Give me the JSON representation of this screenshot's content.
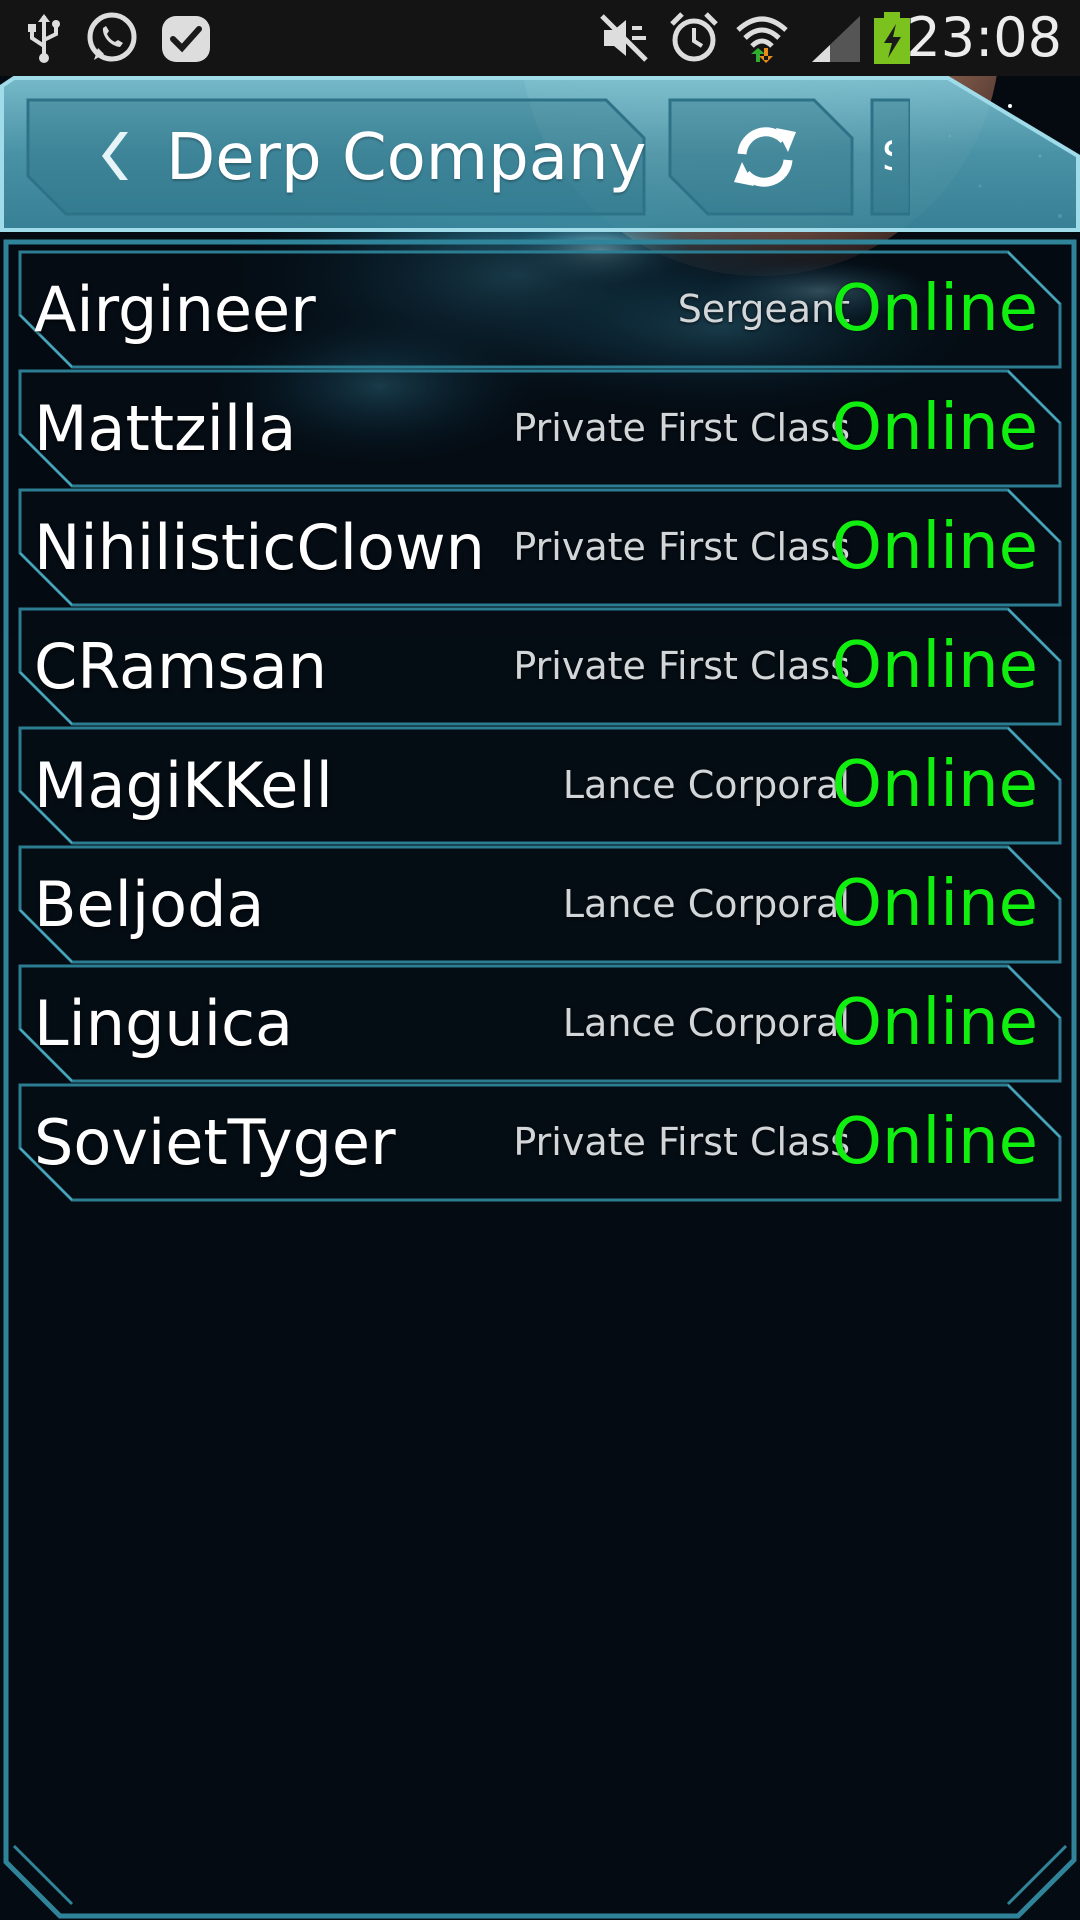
{
  "status_bar": {
    "time": "23:08",
    "icons": [
      "usb-icon",
      "whatsapp-icon",
      "check-app-icon",
      "muted-icon",
      "alarm-icon",
      "wifi-icon",
      "signal-icon",
      "battery-charging-icon"
    ]
  },
  "action_bar": {
    "title": "Derp Company",
    "back_icon": "chevron-left-icon",
    "refresh_icon": "refresh-icon",
    "partial_tab_label": "S"
  },
  "members": [
    {
      "name": "Airgineer",
      "rank": "Sergeant",
      "status": "Online"
    },
    {
      "name": "Mattzilla",
      "rank": "Private First Class",
      "status": "Online"
    },
    {
      "name": "NihilisticClown",
      "rank": "Private First Class",
      "status": "Online"
    },
    {
      "name": "CRamsan",
      "rank": "Private First Class",
      "status": "Online"
    },
    {
      "name": "MagiKKell",
      "rank": "Lance Corporal",
      "status": "Online"
    },
    {
      "name": "Beljoda",
      "rank": "Lance Corporal",
      "status": "Online"
    },
    {
      "name": "Linguica",
      "rank": "Lance Corporal",
      "status": "Online"
    },
    {
      "name": "SovietTyger",
      "rank": "Private First Class",
      "status": "Online"
    }
  ],
  "colors": {
    "status_online": "#11ef11",
    "frame_accent": "#3a8fa3",
    "header_fill": "#5aa6ba",
    "background": "#050b12"
  }
}
